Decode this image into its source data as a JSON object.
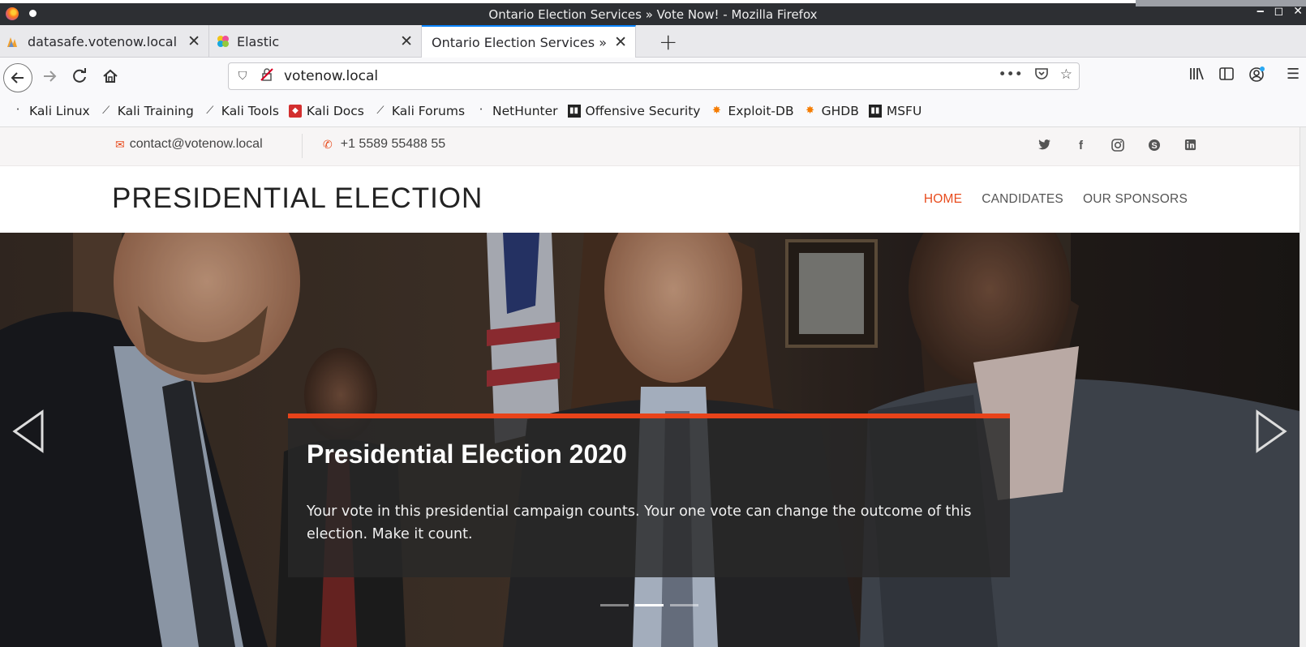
{
  "window": {
    "title": "Ontario Election Services » Vote Now! - Mozilla Firefox",
    "controls": [
      "‒",
      "◻",
      "✕"
    ]
  },
  "tabs": [
    {
      "label": "datasafe.votenow.local / lo",
      "icon": "phpmyadmin-icon",
      "active": false
    },
    {
      "label": "Elastic",
      "icon": "elastic-icon",
      "active": false
    },
    {
      "label": "Ontario Election Services » Vo",
      "icon": "",
      "active": true
    }
  ],
  "navbar": {
    "url": "votenow.local"
  },
  "bookmarks": [
    {
      "label": "Kali Linux",
      "icon": "kali-dragon-icon"
    },
    {
      "label": "Kali Training",
      "icon": "kali-icon"
    },
    {
      "label": "Kali Tools",
      "icon": "kali-icon"
    },
    {
      "label": "Kali Docs",
      "icon": "kali-docs-icon"
    },
    {
      "label": "Kali Forums",
      "icon": "kali-icon"
    },
    {
      "label": "NetHunter",
      "icon": "kali-dragon-icon"
    },
    {
      "label": "Offensive Security",
      "icon": "offsec-icon"
    },
    {
      "label": "Exploit-DB",
      "icon": "exploit-db-icon"
    },
    {
      "label": "GHDB",
      "icon": "exploit-db-icon"
    },
    {
      "label": "MSFU",
      "icon": "offsec-icon"
    }
  ],
  "site": {
    "topbar": {
      "email": "contact@votenow.local",
      "phone": "+1 5589 55488 55",
      "social": [
        "twitter-icon",
        "facebook-icon",
        "instagram-icon",
        "skype-icon",
        "linkedin-icon"
      ]
    },
    "header": {
      "brand": "PRESIDENTIAL ELECTION",
      "nav": [
        "HOME",
        "CANDIDATES",
        "OUR SPONSORS"
      ],
      "active_nav": "HOME"
    },
    "hero": {
      "title": "Presidential Election 2020",
      "text": "Your vote in this presidential campaign counts. Your one vote can change the outcome of this election. Make it count.",
      "slides": 3,
      "active_slide": 2
    },
    "colors": {
      "accent": "#e84c1e"
    }
  }
}
